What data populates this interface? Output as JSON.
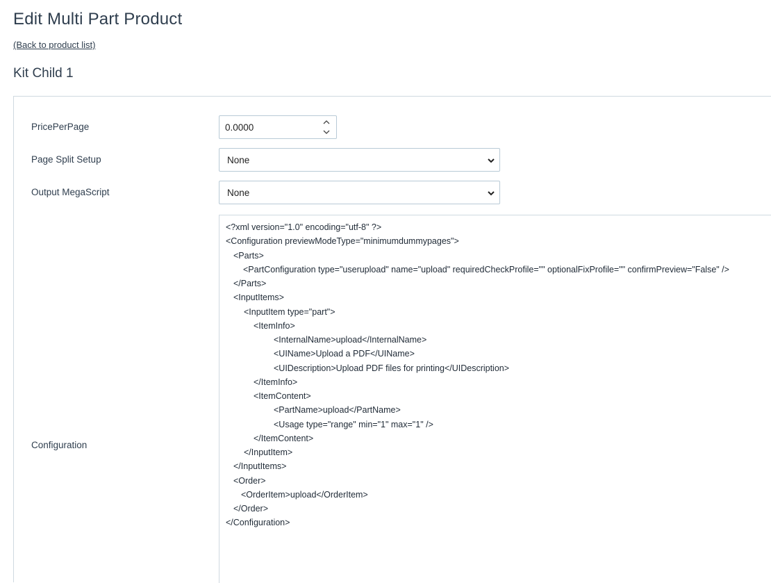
{
  "header": {
    "title": "Edit Multi Part Product",
    "back_link": "(Back to product list)",
    "section_title": "Kit Child 1"
  },
  "form": {
    "price_per_page": {
      "label": "PricePerPage",
      "value": "0.0000"
    },
    "page_split_setup": {
      "label": "Page Split Setup",
      "value": "None"
    },
    "output_megascript": {
      "label": "Output MegaScript",
      "value": "None"
    },
    "configuration": {
      "label": "Configuration",
      "lines": [
        "<?xml version=\"1.0\" encoding=\"utf-8\" ?>",
        "<Configuration previewModeType=\"minimumdummypages\">",
        "<Parts>",
        "<PartConfiguration type=\"userupload\" name=\"upload\" requiredCheckProfile=\"\" optionalFixProfile=\"\" confirmPreview=\"False\" />",
        "</Parts>",
        "<InputItems>",
        "<InputItem type=\"part\">",
        "<ItemInfo>",
        "<InternalName>upload</InternalName>",
        "<UIName>Upload a PDF</UIName>",
        "<UIDescription>Upload PDF files for printing</UIDescription>",
        "</ItemInfo>",
        "<ItemContent>",
        "<PartName>upload</PartName>",
        "<Usage type=\"range\" min=\"1\" max=\"1\" />",
        "</ItemContent>",
        "</InputItem>",
        "</InputItems>",
        "<Order>",
        "<OrderItem>upload</OrderItem>",
        "</Order>",
        "</Configuration>"
      ]
    }
  }
}
